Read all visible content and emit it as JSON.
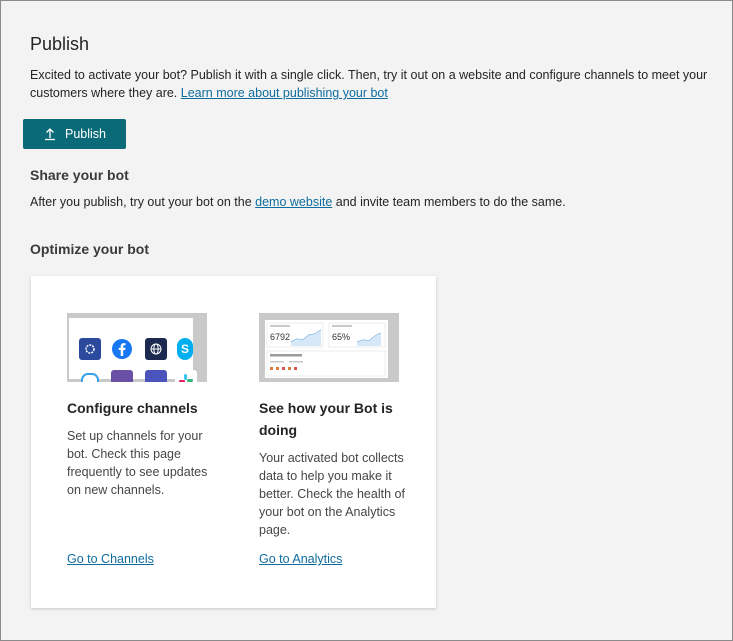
{
  "header": {
    "title": "Publish",
    "intro_text": "Excited to activate your bot? Publish it with a single click. Then, try it out on a website and configure channels to meet your customers where they are.",
    "learn_more_link": "Learn more about publishing your bot"
  },
  "publish_button": {
    "label": "Publish",
    "icon": "upload-icon",
    "color": "#0b6a78"
  },
  "share": {
    "title": "Share your bot",
    "text_before": "After you publish, try out your bot on the",
    "link": "demo website",
    "text_after": "and invite team members to do the same."
  },
  "optimize": {
    "title": "Optimize your bot",
    "cards": [
      {
        "title": "Configure channels",
        "description": "Set up channels for your bot. Check this page frequently to see updates on new channels.",
        "link": "Go to Channels",
        "thumbnail_icons": [
          "web-chat-icon",
          "facebook-icon",
          "globe-icon",
          "skype-icon",
          "teams-icon",
          "slack-icon"
        ]
      },
      {
        "title": "See how your Bot is doing",
        "description": "Your activated bot collects data to help you make it better. Check the health of your bot on the Analytics page.",
        "link": "Go to Analytics",
        "thumbnail_stats": [
          "6792",
          "65%"
        ]
      }
    ]
  },
  "colors": {
    "link": "#0f6c9e",
    "background": "#f3f3f3",
    "card": "#ffffff"
  }
}
